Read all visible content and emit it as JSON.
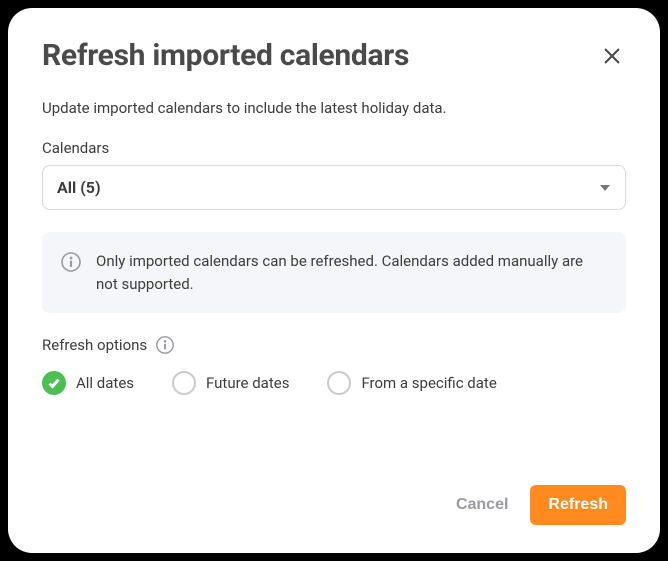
{
  "dialog": {
    "title": "Refresh imported calendars",
    "description": "Update imported calendars to include the latest holiday data."
  },
  "calendars": {
    "label": "Calendars",
    "selected": "All (5)"
  },
  "banner": {
    "text": "Only imported calendars can be refreshed. Calendars added manually are not supported."
  },
  "options": {
    "label": "Refresh options",
    "items": [
      {
        "label": "All dates",
        "checked": true
      },
      {
        "label": "Future dates",
        "checked": false
      },
      {
        "label": "From a specific date",
        "checked": false
      }
    ]
  },
  "footer": {
    "cancel": "Cancel",
    "confirm": "Refresh"
  }
}
